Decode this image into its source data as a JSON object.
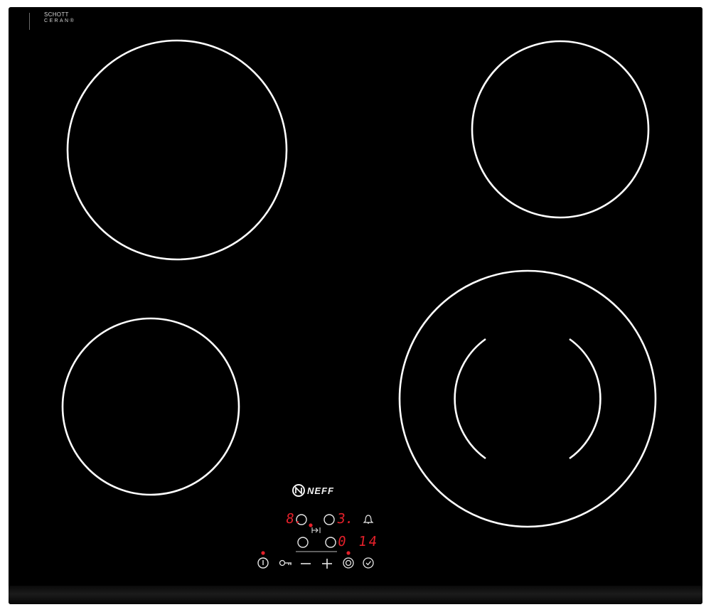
{
  "brand": {
    "ceran_line1": "SCHOTT",
    "ceran_line2": "CERAN®",
    "maker": "NEFF"
  },
  "displays": {
    "zone_left_level": "8.",
    "zone_right_level": "3.",
    "zone_lower_level": "0",
    "timer_value": "14"
  },
  "icons": {
    "power": "power-icon",
    "child_lock": "key-icon",
    "minus": "minus-icon",
    "plus": "plus-icon",
    "timer": "timer-icon",
    "clock": "clock-icon",
    "alarm": "bell-icon",
    "dual_zone": "dual-zone-icon"
  },
  "colors": {
    "glass": "#000000",
    "zone_ring": "#ffffff",
    "display": "#e4202a"
  }
}
